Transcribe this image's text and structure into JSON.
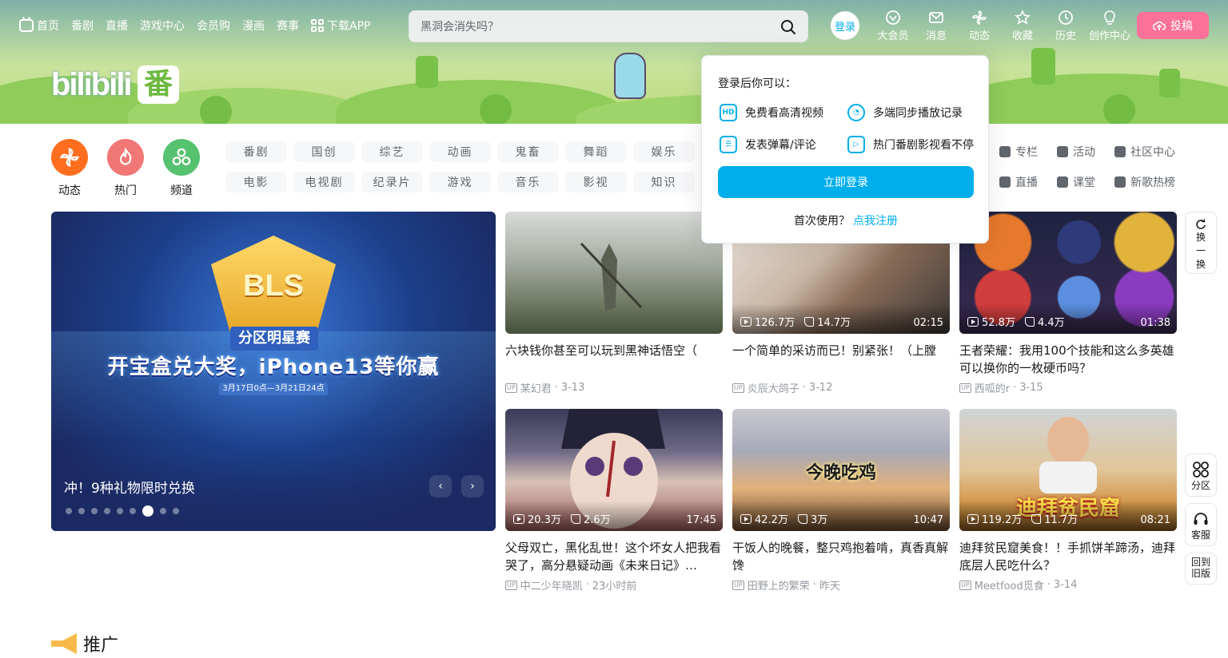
{
  "nav": {
    "left": [
      "首页",
      "番剧",
      "直播",
      "游戏中心",
      "会员购",
      "漫画",
      "赛事",
      "下载APP"
    ],
    "search_placeholder": "黑洞会消失吗？",
    "login_avatar": "登录",
    "right": [
      "大会员",
      "消息",
      "动态",
      "收藏",
      "历史",
      "创作中心"
    ],
    "upload": "投稿"
  },
  "logo": {
    "text": "bilibili",
    "fan": "番"
  },
  "quick": [
    {
      "label": "动态",
      "color": "#ff6e1f"
    },
    {
      "label": "热门",
      "color": "#f07775"
    },
    {
      "label": "频道",
      "color": "#56c16e"
    }
  ],
  "channels": [
    "番剧",
    "国创",
    "综艺",
    "动画",
    "鬼畜",
    "舞蹈",
    "娱乐",
    "",
    "电影",
    "电视剧",
    "纪录片",
    "游戏",
    "音乐",
    "影视",
    "知识",
    ""
  ],
  "side_links": [
    "专栏",
    "活动",
    "社区中心",
    "直播",
    "课堂",
    "新歌热榜"
  ],
  "carousel": {
    "badge": "BLS",
    "sub": "分区明星赛",
    "headline": "开宝盒兑大奖，iPhone13等你赢",
    "dates": "3月17日0点—3月21日24点",
    "title": "冲！9种礼物限时兑换",
    "prev": "‹",
    "next": "›",
    "dot_count": 9,
    "active_dot": 6
  },
  "videos": [
    {
      "title": "六块钱你甚至可以玩到黑神话悟空（",
      "author": "某幻君",
      "date": "3-13",
      "views": "",
      "likes": "",
      "duration": ""
    },
    {
      "title": "一个简单的采访而已！别紧张！（上膛",
      "author": "炎辰大鸽子",
      "date": "3-12",
      "views": "126.7万",
      "likes": "14.7万",
      "duration": "02:15"
    },
    {
      "title": "王者荣耀：我用100个技能和这么多英雄可以换你的一枚硬币吗？",
      "author": "西呱的r",
      "date": "3-15",
      "views": "52.8万",
      "likes": "4.4万",
      "duration": "01:38"
    },
    {
      "title": "父母双亡，黑化乱世！这个坏女人把我看哭了，高分悬疑动画《未来日记》…",
      "author": "中二少年晓凯",
      "date": "23小时前",
      "views": "20.3万",
      "likes": "2.6万",
      "duration": "17:45"
    },
    {
      "title": "干饭人的晚餐，整只鸡抱着啃，真香真解馋",
      "author": "田野上的繁荣",
      "date": "昨天",
      "views": "42.2万",
      "likes": "3万",
      "duration": "10:47"
    },
    {
      "title": "迪拜贫民窟美食！！手抓饼羊蹄汤，迪拜底层人民吃什么？",
      "author": "Meetfood觅食",
      "date": "3-14",
      "views": "119.2万",
      "likes": "11.7万",
      "duration": "08:21"
    }
  ],
  "thumb_captions": {
    "v5": "今晚吃鸡",
    "v6": "迪拜贫民窟"
  },
  "up_tag": "UP",
  "popup": {
    "title": "登录后你可以：",
    "perks": [
      "免费看高清视频",
      "多端同步播放记录",
      "发表弹幕/评论",
      "热门番剧影视看不停"
    ],
    "perk_hd": "HD",
    "login_btn": "立即登录",
    "first_use": "首次使用？",
    "register": "点我注册"
  },
  "float": {
    "refresh": [
      "换",
      "一",
      "换"
    ],
    "zone": "分区",
    "service": "客服",
    "old": [
      "回到",
      "旧版"
    ]
  },
  "promo": {
    "title": "推广"
  }
}
